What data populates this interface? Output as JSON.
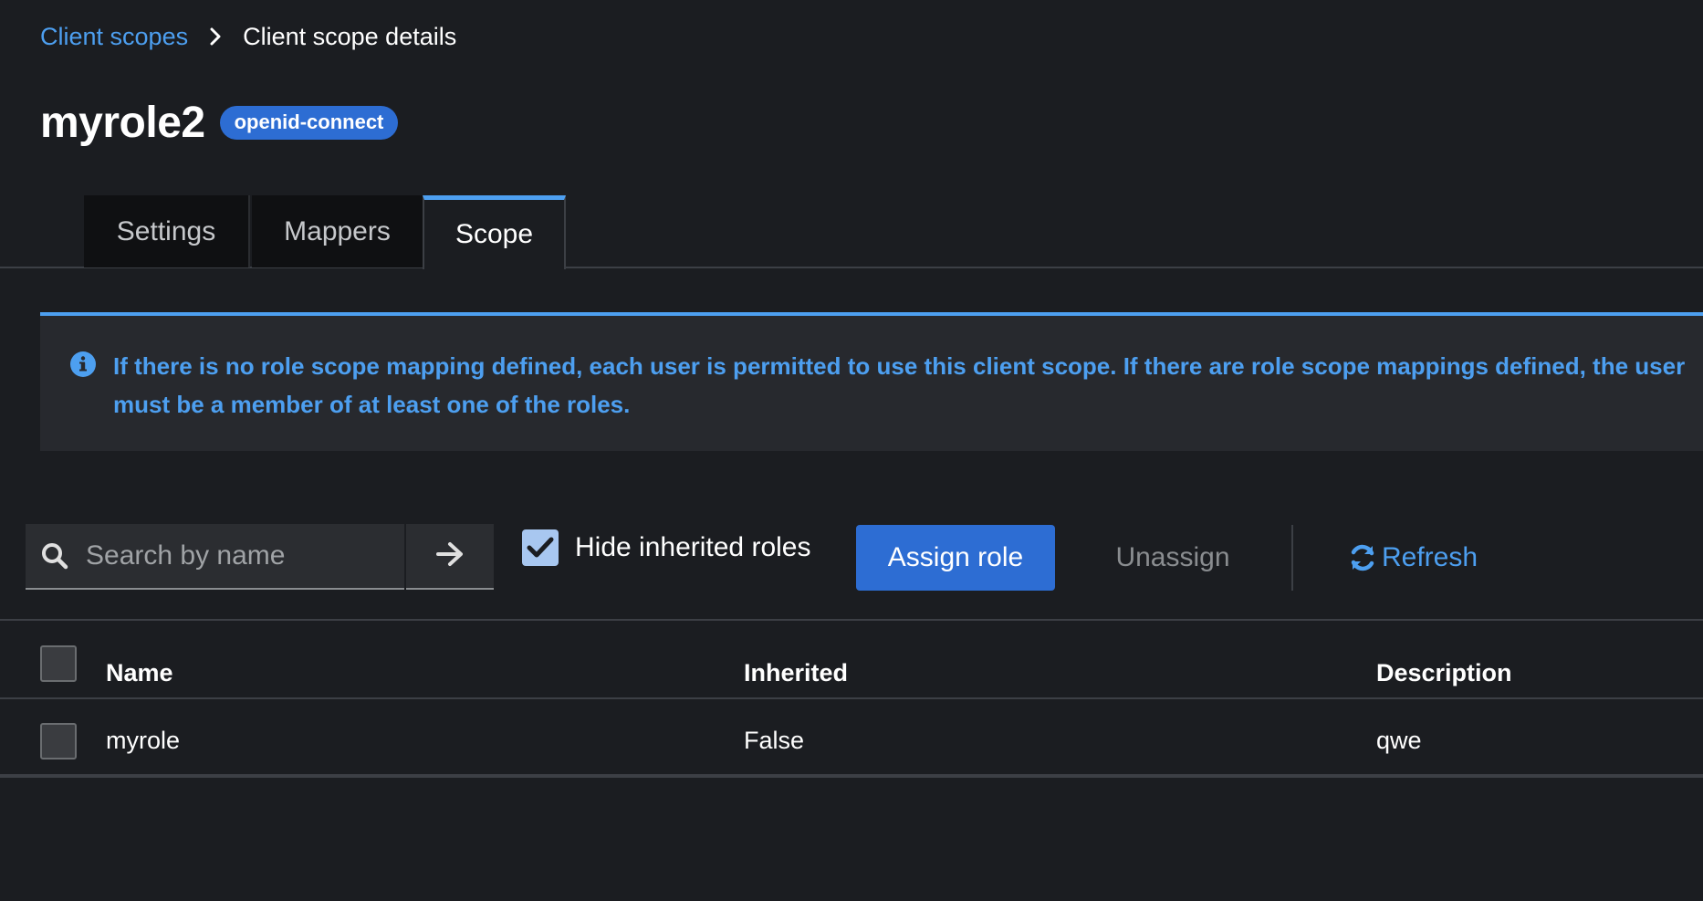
{
  "breadcrumb": {
    "parent": "Client scopes",
    "current": "Client scope details"
  },
  "header": {
    "title": "myrole2",
    "badge": "openid-connect"
  },
  "tabs": [
    {
      "label": "Settings",
      "active": false
    },
    {
      "label": "Mappers",
      "active": false
    },
    {
      "label": "Scope",
      "active": true
    }
  ],
  "alert": {
    "icon": "info-circle-icon",
    "text": "If there is no role scope mapping defined, each user is permitted to use this client scope. If there are role scope mappings defined, the user must be a member of at least one of the roles."
  },
  "toolbar": {
    "search_placeholder": "Search by name",
    "search_value": "",
    "hide_inherited_label": "Hide inherited roles",
    "hide_inherited_checked": true,
    "assign_label": "Assign role",
    "unassign_label": "Unassign",
    "refresh_label": "Refresh"
  },
  "table": {
    "columns": [
      "Name",
      "Inherited",
      "Description"
    ],
    "rows": [
      {
        "name": "myrole",
        "inherited": "False",
        "description": "qwe"
      }
    ]
  },
  "colors": {
    "background": "#1b1d21",
    "accent": "#4d9ff0",
    "primary_button": "#2d6dd3"
  }
}
